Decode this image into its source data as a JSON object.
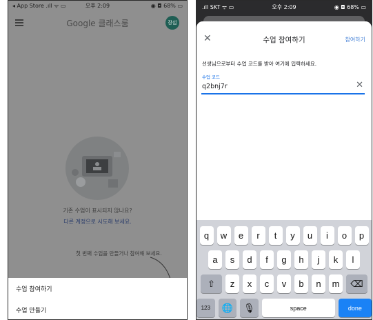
{
  "left": {
    "status": {
      "left": "◂ App Store .ıll ᯤ ▭",
      "center": "오후 2:09",
      "right": "◉ ◘ 68% ▭"
    },
    "appbar": {
      "title": "Google 클래스룸",
      "avatar": "장섭"
    },
    "empty_state": {
      "question": "기존 수업이 표시되지 않나요?",
      "link": "다른 계정으로 시도해 보세요.",
      "hint": "첫 번째 수업을 만들거나 참여해 보세요."
    },
    "sheet": {
      "join": "수업 참여하기",
      "create": "수업 만들기"
    }
  },
  "right": {
    "status": {
      "left": ".ıll SKT ᯤ ▭",
      "center": "오후 2:09",
      "right": "◉ ◘ 68% ▭"
    },
    "header": {
      "close": "✕",
      "title": "수업 참여하기",
      "join": "참여하기"
    },
    "form": {
      "instruction": "선생님으로부터 수업 코드를 받아 여기에 입력하세요.",
      "label": "수업 코드",
      "value": "q2bnj7r",
      "clear": "✕"
    },
    "keyboard": {
      "row1": [
        "q",
        "w",
        "e",
        "r",
        "t",
        "y",
        "u",
        "i",
        "o",
        "p"
      ],
      "row2": [
        "a",
        "s",
        "d",
        "f",
        "g",
        "h",
        "j",
        "k",
        "l"
      ],
      "row3": [
        "z",
        "x",
        "c",
        "v",
        "b",
        "n",
        "m"
      ],
      "shift": "⇧",
      "backspace": "⌫",
      "numbers": "123",
      "globe": "🌐",
      "mic": "🎙",
      "space": "space",
      "done": "done"
    }
  }
}
